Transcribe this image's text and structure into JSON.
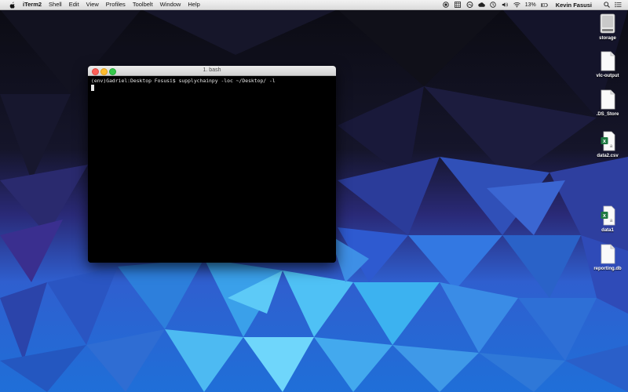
{
  "menubar": {
    "app_name": "iTerm2",
    "items": [
      "Shell",
      "Edit",
      "View",
      "Profiles",
      "Toolbelt",
      "Window",
      "Help"
    ],
    "battery_percent": "13%",
    "user_name": "Kevin Fasusi"
  },
  "terminal": {
    "title": "1. bash",
    "prompt_line": "(env)Gadriel:Desktop Fosusi$ supplychainpy -loc ~/Desktop/ -l"
  },
  "desktop": {
    "icons": [
      {
        "label": "storage",
        "icon": "disk-drive-icon"
      },
      {
        "label": "vlc-output",
        "icon": "document-icon"
      },
      {
        "label": ".DS_Store",
        "icon": "document-icon"
      },
      {
        "label": "data2.csv",
        "icon": "excel-csv-icon"
      },
      {
        "label": "data1",
        "icon": "excel-csv-icon"
      },
      {
        "label": "reporting.db",
        "icon": "document-icon"
      }
    ]
  }
}
